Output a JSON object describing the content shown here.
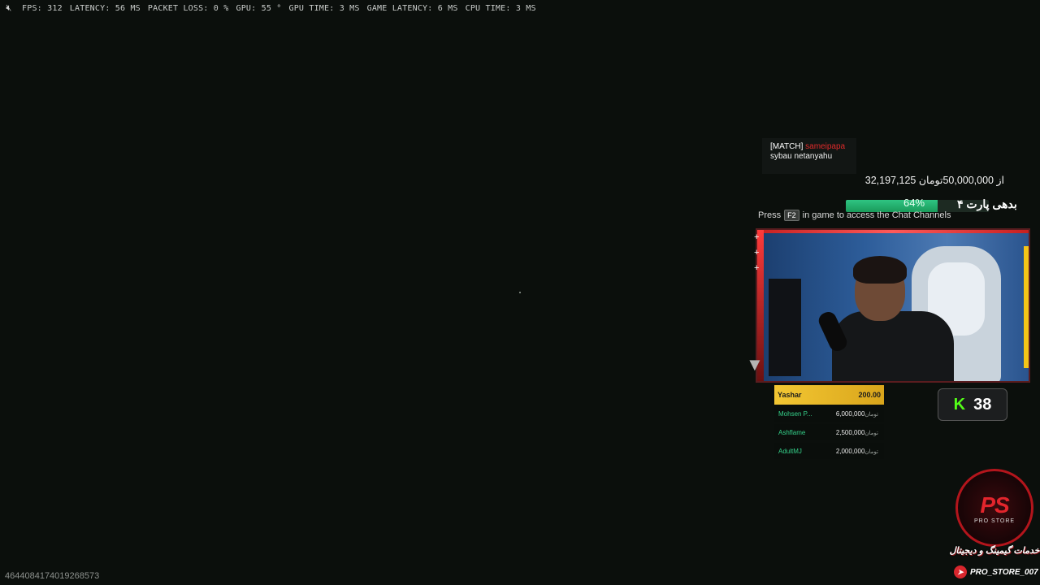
{
  "stats": [
    {
      "label": "FPS:",
      "value": "312"
    },
    {
      "label": "LATENCY:",
      "value": "56 MS"
    },
    {
      "label": "PACKET LOSS:",
      "value": "0 %"
    },
    {
      "label": "GPU:",
      "value": "55 °"
    },
    {
      "label": "GPU TIME:",
      "value": "3 MS"
    },
    {
      "label": "GAME LATENCY:",
      "value": "6 MS"
    },
    {
      "label": "CPU TIME:",
      "value": "3 MS"
    }
  ],
  "chat": {
    "tag": "[MATCH]",
    "user": "sameipapa",
    "message": "sybau netanyahu"
  },
  "donation_goal": {
    "progress_text": "32,197,125 از 50,000,000تومان",
    "title": "بدهی پارت ۴",
    "percent_label": "64%",
    "fill_fraction": 0.64
  },
  "hint": {
    "prefix": "Press",
    "key": "F2",
    "suffix": "in game to access the Chat Channels"
  },
  "kill_counter": {
    "icon": "kick-icon",
    "glyph": "K",
    "count": "38"
  },
  "leaderboard": {
    "top": {
      "name": "Yashar",
      "amount": "200.00"
    },
    "rows": [
      {
        "name": "Mohsen P...",
        "unit": "تومان",
        "amount": "6,000,000"
      },
      {
        "name": "Ashflame",
        "unit": "تومان",
        "amount": "2,500,000"
      },
      {
        "name": "AdultMJ",
        "unit": "تومان",
        "amount": "2,000,000"
      }
    ]
  },
  "store": {
    "logo_mark": "PS",
    "logo_sub": "PRO STORE",
    "tagline": "خدمات گیمینگ و دیجیتال",
    "handle": "PRO_STORE_007"
  },
  "session_id": "4644084174019268573",
  "colors": {
    "background": "#0b0f0c",
    "accent_gold": "#f3c733",
    "accent_green": "#2fc482",
    "accent_red": "#e02a2a",
    "kick_green": "#53fc18"
  }
}
